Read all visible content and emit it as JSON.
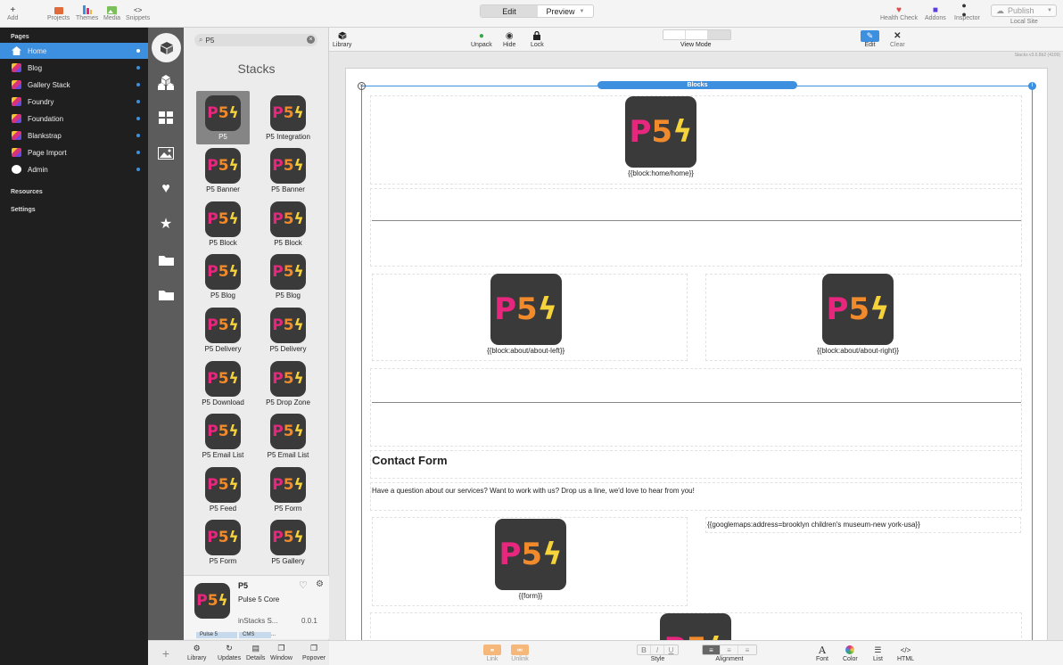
{
  "toolbar": {
    "add": "Add",
    "projects": "Projects",
    "themes": "Themes",
    "media": "Media",
    "snippets": "Snippets",
    "edit": "Edit",
    "preview": "Preview",
    "health_check": "Health Check",
    "addons": "Addons",
    "inspector": "Inspector",
    "publish": "Publish",
    "local_site": "Local Site"
  },
  "sidebar": {
    "pages_header": "Pages",
    "pages": [
      {
        "label": "Home",
        "active": true
      },
      {
        "label": "Blog"
      },
      {
        "label": "Gallery Stack"
      },
      {
        "label": "Foundry"
      },
      {
        "label": "Foundation"
      },
      {
        "label": "Blankstrap"
      },
      {
        "label": "Page Import"
      },
      {
        "label": "Admin"
      }
    ],
    "resources": "Resources",
    "settings": "Settings"
  },
  "library": {
    "search_value": "P5",
    "title": "Stacks",
    "items": [
      "P5",
      "P5  Integration",
      "P5 Banner",
      "P5 Banner",
      "P5 Block",
      "P5 Block",
      "P5 Blog",
      "P5 Blog",
      "P5 Delivery",
      "P5 Delivery",
      "P5 Download",
      "P5 Drop Zone",
      "P5 Email List",
      "P5 Email List",
      "P5 Feed",
      "P5 Form",
      "P5 Form",
      "P5 Gallery"
    ],
    "logo": {
      "p": "P",
      "five": "5",
      "bolt": "ϟ"
    },
    "info": {
      "name": "P5",
      "subtitle": "Pulse 5 Core",
      "vendor": "inStacks S...",
      "version": "0.0.1",
      "tags": [
        "Pulse 5",
        "CMS",
        "..."
      ]
    },
    "bottom": [
      "Library",
      "Updates",
      "Details",
      "Window",
      "Popover"
    ]
  },
  "edit_toolbar": {
    "library": "Library",
    "unpack": "Unpack",
    "hide": "Hide",
    "lock": "Lock",
    "view_mode": "View Mode",
    "edit": "Edit",
    "clear": "Clear"
  },
  "canvas": {
    "version": "Stacks v3.6.8b2 (4109)",
    "blocks_label": "Blocks",
    "home_block": "{{block:home/home}}",
    "about_left": "{{block:about/about-left}}",
    "about_right": "{{block:about/about-right}}",
    "contact_title": "Contact Form",
    "contact_text": "Have a question about our services? Want to work with us? Drop us a line, we'd love to hear from you!",
    "form": "{{form}}",
    "maps": "{{googlemaps:address=brooklyn children's museum-new york-usa}}"
  },
  "bottom_bar": {
    "link": "Link",
    "unlink": "Unlink",
    "style": "Style",
    "alignment": "Alignment",
    "font": "Font",
    "color": "Color",
    "list": "List",
    "html": "HTML"
  },
  "colors": {
    "accent": "#3d8fe0",
    "sidebar": "#1f1f1f",
    "p5_pink": "#e6277d",
    "p5_orange": "#f18a2a",
    "p5_yellow": "#f6d33a"
  }
}
